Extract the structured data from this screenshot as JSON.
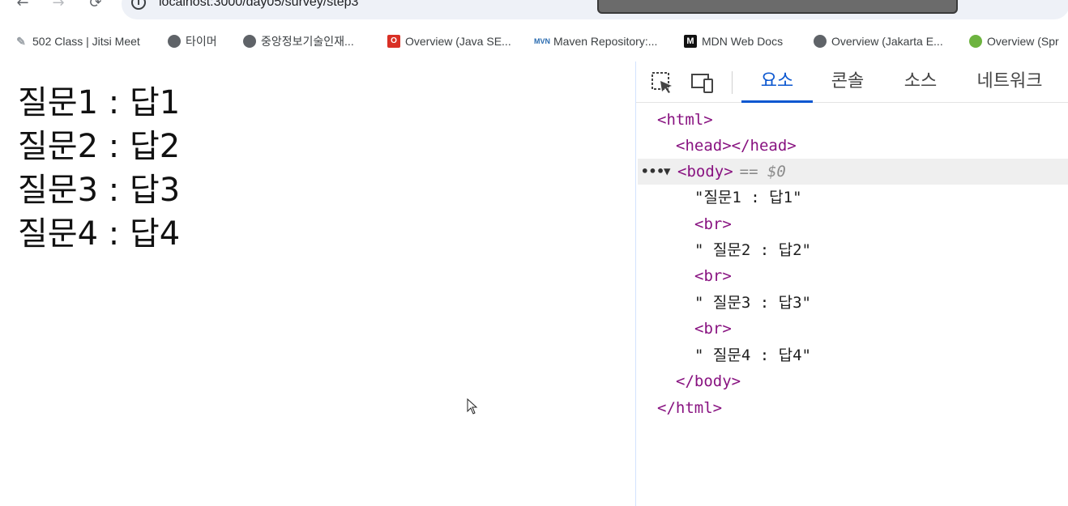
{
  "browser": {
    "url": "localhost:3000/day05/survey/step3",
    "bookmarks": [
      {
        "label": "502 Class | Jitsi Meet",
        "icon": "feather-icon"
      },
      {
        "label": "타이머",
        "icon": "globe-icon"
      },
      {
        "label": "중앙정보기술인재...",
        "icon": "globe-icon"
      },
      {
        "label": "Overview (Java SE...",
        "icon": "oracle-icon"
      },
      {
        "label": "Maven Repository:...",
        "icon": "maven-icon"
      },
      {
        "label": "MDN Web Docs",
        "icon": "mdn-icon"
      },
      {
        "label": "Overview (Jakarta E...",
        "icon": "globe-icon"
      },
      {
        "label": "Overview (Spr",
        "icon": "spring-icon"
      }
    ],
    "icon_labels": {
      "oracle": "O",
      "maven": "MVN",
      "mdn": "M"
    }
  },
  "page": {
    "lines": [
      "질문1 : 답1",
      "질문2 : 답2",
      "질문3 : 답3",
      "질문4 : 답4"
    ]
  },
  "devtools": {
    "tabs": [
      "요소",
      "콘솔",
      "소스",
      "네트워크"
    ],
    "active_tab": "요소",
    "selected_marker": "== $0",
    "dom": {
      "html_open": "<html>",
      "head": "<head></head>",
      "body_open": "<body>",
      "text1": "\"질문1 : 답1\"",
      "br": "<br>",
      "text2": "\" 질문2 : 답2\"",
      "text3": "\" 질문3 : 답3\"",
      "text4": "\" 질문4 : 답4\"",
      "body_close": "</body>",
      "html_close": "</html>"
    }
  },
  "colors": {
    "accent": "#0b57d0",
    "tag": "#881280"
  }
}
